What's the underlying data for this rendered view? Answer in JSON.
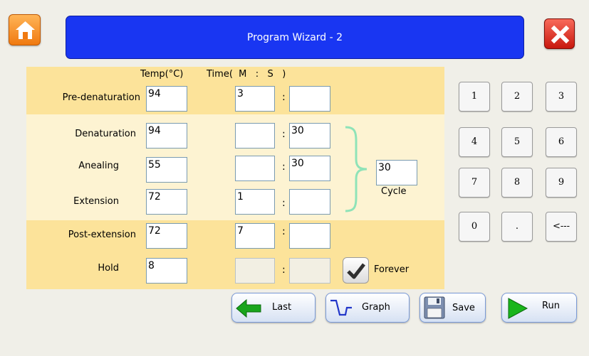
{
  "window": {
    "title": "Program  Wizard - 2"
  },
  "header": {
    "temp": "Temp(°C)",
    "time": "Time(  M   :   S   )"
  },
  "rows": {
    "predenaturation": {
      "label": "Pre-denaturation",
      "temp": "94",
      "min": "3",
      "sec": ""
    },
    "denaturation": {
      "label": "Denaturation",
      "temp": "94",
      "min": "",
      "sec": "30"
    },
    "annealing": {
      "label": "Anealing",
      "temp": "55",
      "min": "",
      "sec": "30"
    },
    "extension": {
      "label": "Extension",
      "temp": "72",
      "min": "1",
      "sec": ""
    },
    "postextension": {
      "label": "Post-extension",
      "temp": "72",
      "min": "7",
      "sec": ""
    },
    "hold": {
      "label": "Hold",
      "temp": "8",
      "min": "",
      "sec": ""
    }
  },
  "colon": ":",
  "cycle": {
    "value": "30",
    "label": "Cycle"
  },
  "forever": {
    "label": "Forever",
    "checked": true
  },
  "keypad": [
    "1",
    "2",
    "3",
    "4",
    "5",
    "6",
    "7",
    "8",
    "9",
    "0",
    ".",
    "<---"
  ],
  "actions": {
    "last": "Last",
    "graph": "Graph",
    "save": "Save",
    "run": "Run"
  },
  "colors": {
    "title_bar": "#1936f2",
    "band_dark": "#fce39a",
    "band_light": "#fdf3d2",
    "home": "#f07a10",
    "close": "#c8180e"
  },
  "icons": {
    "home": "home-icon",
    "close": "close-icon",
    "last": "left-arrow-icon",
    "graph": "graph-icon",
    "save": "floppy-disk-icon",
    "run": "play-icon",
    "check": "checkmark-icon"
  }
}
